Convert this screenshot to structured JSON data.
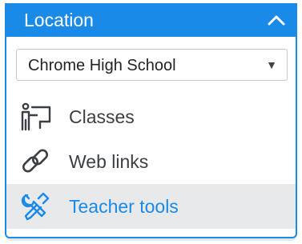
{
  "location": {
    "title": "Location",
    "selected_school": "Chrome High School",
    "dropdown_arrow": "▼",
    "expanded": true
  },
  "menu": [
    {
      "label": "Classes",
      "icon": "classroom-teacher-icon",
      "active": false
    },
    {
      "label": "Web links",
      "icon": "link-icon",
      "active": false
    },
    {
      "label": "Teacher tools",
      "icon": "tools-icon",
      "active": true
    }
  ],
  "colors": {
    "accent": "#1a8ae8",
    "text": "#3b3f44",
    "active_bg": "#e8e9eb"
  }
}
